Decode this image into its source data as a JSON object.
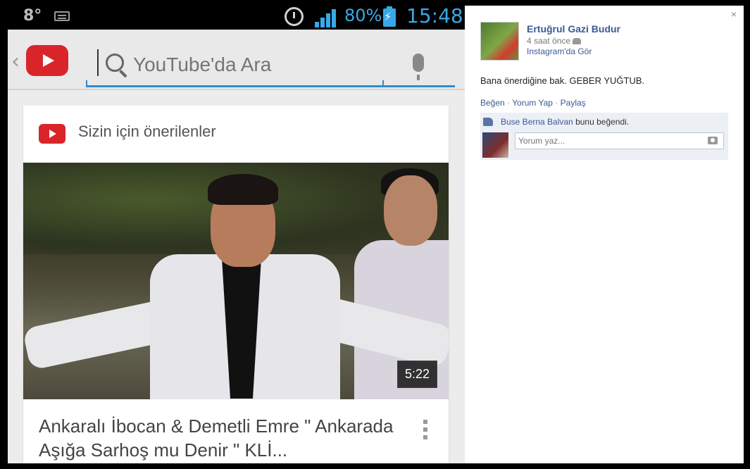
{
  "phone": {
    "status": {
      "temp": "8°",
      "battery": "80%",
      "time": "15:48"
    },
    "search": {
      "placeholder": "YouTube'da Ara"
    },
    "section_title": "Sizin için önerilenler",
    "video": {
      "duration": "5:22",
      "title": "Ankaralı İbocan & Demetli Emre \" Ankarada Aşığa Sarhoş mu Denir \" KLİ..."
    },
    "colors": {
      "youtube_red": "#d9252a",
      "status_blue": "#37a8e7",
      "search_line": "#2c8dd6"
    }
  },
  "fb": {
    "close": "×",
    "author": "Ertuğrul Gazi Budur",
    "time": "4 saat önce",
    "instagram_link": "Instagram'da Gör",
    "post_text": "Bana önerdiğine bak. GEBER YUĞTUB.",
    "actions": {
      "like": "Beğen",
      "comment": "Yorum Yap",
      "share": "Paylaş",
      "sep": " · "
    },
    "likes": {
      "liker": "Buse Berna Balvan",
      "suffix": " bunu beğendi."
    },
    "comment_placeholder": "Yorum yaz...",
    "colors": {
      "link": "#3b5998"
    }
  }
}
